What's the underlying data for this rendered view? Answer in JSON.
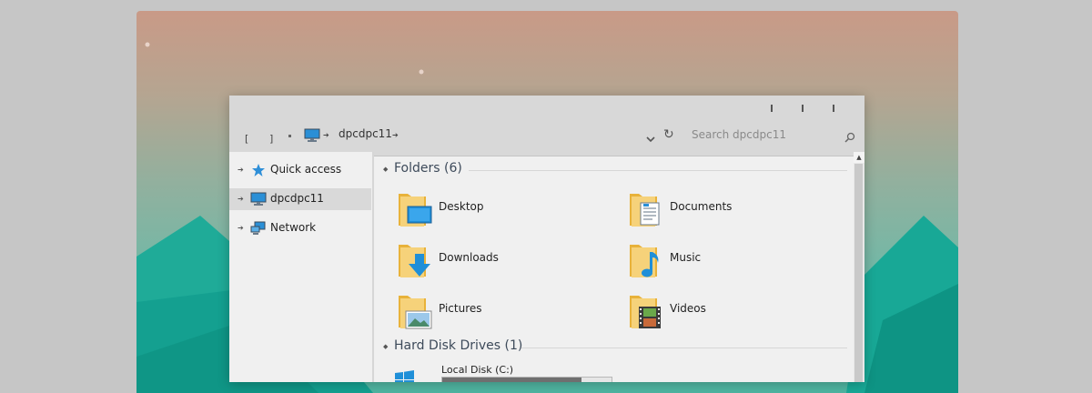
{
  "window": {
    "caption_buttons": [
      "minimize-icon",
      "maximize-icon",
      "close-icon"
    ]
  },
  "address_bar": {
    "back": "[",
    "forward": "]",
    "path": "dpcdpc11",
    "search_placeholder": "Search dpcdpc11"
  },
  "nav_pane": {
    "items": [
      {
        "label": "Quick access",
        "icon": "quick-access-star-icon"
      },
      {
        "label": "dpcdpc11",
        "icon": "computer-icon",
        "selected": true
      },
      {
        "label": "Network",
        "icon": "network-icon"
      }
    ]
  },
  "content": {
    "folders_header": "Folders (6)",
    "folders": [
      {
        "label": "Desktop",
        "icon": "desktop-folder-icon"
      },
      {
        "label": "Documents",
        "icon": "documents-folder-icon"
      },
      {
        "label": "Downloads",
        "icon": "downloads-folder-icon"
      },
      {
        "label": "Music",
        "icon": "music-folder-icon"
      },
      {
        "label": "Pictures",
        "icon": "pictures-folder-icon"
      },
      {
        "label": "Videos",
        "icon": "videos-folder-icon"
      }
    ],
    "drives_header": "Hard Disk Drives (1)",
    "drives": [
      {
        "label": "Local Disk (C:)",
        "icon": "windows-drive-icon",
        "used_fraction": 0.82
      }
    ]
  },
  "colors": {
    "accent": "#1f8fd8",
    "folder": "#f4c85a",
    "wallpaper_teal": "#17a898"
  }
}
